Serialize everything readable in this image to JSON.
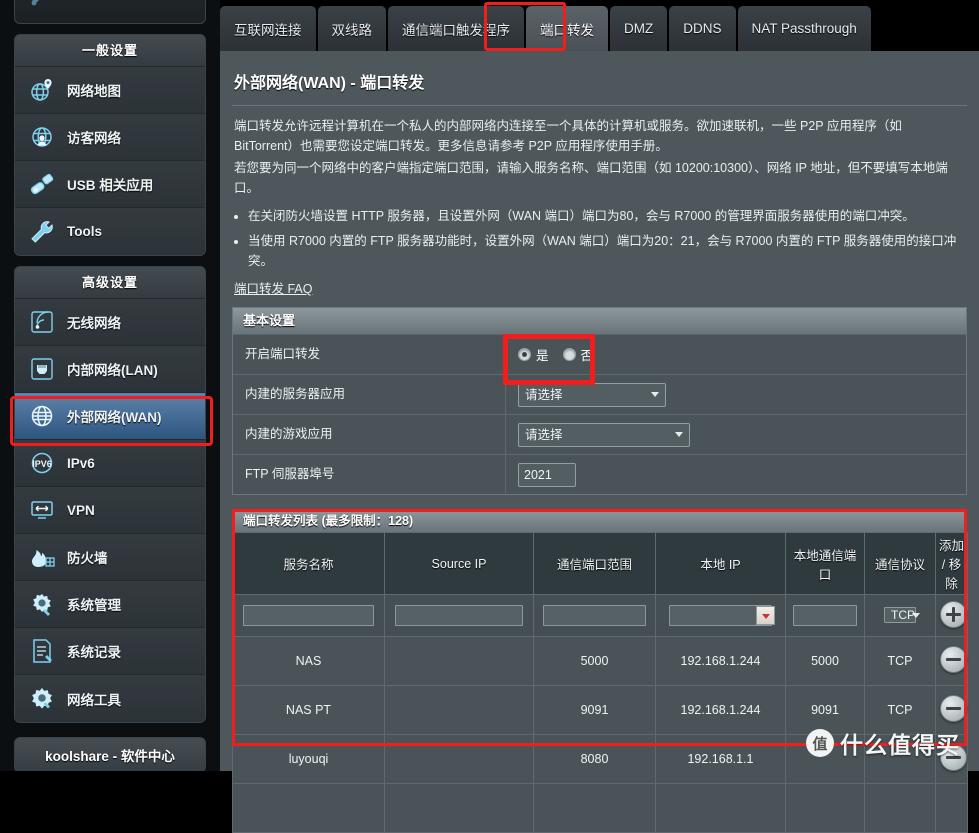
{
  "sidebar": {
    "partial_top_item": {
      "label": ""
    },
    "sections": [
      {
        "title": "一般设置",
        "items": [
          {
            "label": "网络地图",
            "icon": "network-map-icon",
            "active": false
          },
          {
            "label": "访客网络",
            "icon": "guest-network-icon",
            "active": false
          },
          {
            "label": "USB 相关应用",
            "icon": "usb-icon",
            "active": false
          },
          {
            "label": "Tools",
            "icon": "wrench-icon",
            "active": false
          }
        ]
      },
      {
        "title": "高级设置",
        "items": [
          {
            "label": "无线网络",
            "icon": "wireless-icon",
            "active": false
          },
          {
            "label": "内部网络(LAN)",
            "icon": "lan-icon",
            "active": false
          },
          {
            "label": "外部网络(WAN)",
            "icon": "wan-globe-icon",
            "active": true
          },
          {
            "label": "IPv6",
            "icon": "ipv6-icon",
            "active": false
          },
          {
            "label": "VPN",
            "icon": "vpn-icon",
            "active": false
          },
          {
            "label": "防火墙",
            "icon": "firewall-icon",
            "active": false
          },
          {
            "label": "系统管理",
            "icon": "administration-icon",
            "active": false
          },
          {
            "label": "系统记录",
            "icon": "system-log-icon",
            "active": false
          },
          {
            "label": "网络工具",
            "icon": "network-tools-icon",
            "active": false
          }
        ]
      }
    ],
    "footer_button": "koolshare - 软件中心"
  },
  "tabs": [
    {
      "label": "互联网连接",
      "selected": false
    },
    {
      "label": "双线路",
      "selected": false
    },
    {
      "label": "通信端口触发程序",
      "selected": false
    },
    {
      "label": "端口转发",
      "selected": true
    },
    {
      "label": "DMZ",
      "selected": false
    },
    {
      "label": "DDNS",
      "selected": false
    },
    {
      "label": "NAT Passthrough",
      "selected": false
    }
  ],
  "page": {
    "title": "外部网络(WAN) - 端口转发",
    "description_paragraphs": [
      "端口转发允许远程计算机在一个私人的内部网络内连接至一个具体的计算机或服务。欲加速联机，一些 P2P 应用程序（如 BitTorrent）也需要您设定端口转发。更多信息请参考 P2P 应用程序使用手册。",
      "若您要为同一个网络中的客户端指定端口范围，请输入服务名称、端口范围（如 10200:10300）、网络 IP 地址，但不要填写本地端口。"
    ],
    "notes": [
      "在关闭防火墙设置 HTTP 服务器，且设置外网（WAN 端口）端口为80，会与 R7000 的管理界面服务器使用的端口冲突。",
      "当使用 R7000 内置的 FTP 服务器功能时，设置外网（WAN 端口）端口为20：21，会与 R7000 内置的 FTP 服务器使用的接口冲突。"
    ],
    "faq_link": "端口转发 FAQ"
  },
  "basic_settings": {
    "section_title": "基本设置",
    "rows": {
      "enable_label": "开启端口转发",
      "radio_yes": "是",
      "radio_no": "否",
      "radio_selected": "是",
      "server_app_label": "内建的服务器应用",
      "server_app_value": "请选择",
      "game_app_label": "内建的游戏应用",
      "game_app_value": "请选择",
      "ftp_port_label": "FTP 伺服器埠号",
      "ftp_port_value": "2021"
    }
  },
  "port_forward_list": {
    "section_title": "端口转发列表 (最多限制：128)",
    "columns": [
      "服务名称",
      "Source IP",
      "通信端口范围",
      "本地 IP",
      "本地通信端口",
      "通信协议",
      "添加 / 移除"
    ],
    "new_row": {
      "service_name": "",
      "source_ip": "",
      "port_range": "",
      "local_ip": "",
      "local_port": "",
      "protocol": "TCP",
      "action": "add"
    },
    "rows": [
      {
        "service_name": "NAS",
        "source_ip": "",
        "port_range": "5000",
        "local_ip": "192.168.1.244",
        "local_port": "5000",
        "protocol": "TCP",
        "action": "remove"
      },
      {
        "service_name": "NAS PT",
        "source_ip": "",
        "port_range": "9091",
        "local_ip": "192.168.1.244",
        "local_port": "9091",
        "protocol": "TCP",
        "action": "remove"
      },
      {
        "service_name": "luyouqi",
        "source_ip": "",
        "port_range": "8080",
        "local_ip": "192.168.1.1",
        "local_port": "",
        "protocol": "",
        "action": "remove"
      }
    ]
  },
  "watermark": {
    "logo_char": "值",
    "text": "什么值得买"
  },
  "colors": {
    "accent_highlight": "#f21d1d",
    "panel_bg": "#4e585c",
    "sidebar_bg": "#0c0f11",
    "active_item": "#2d5580"
  }
}
